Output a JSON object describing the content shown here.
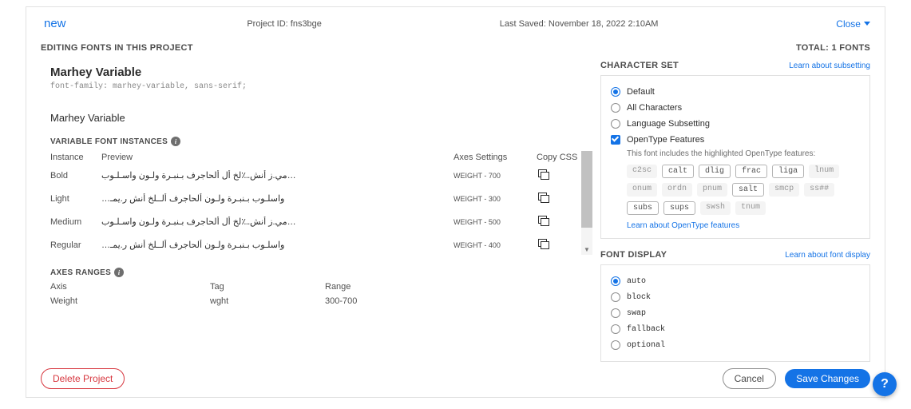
{
  "header": {
    "project_name": "new",
    "project_id_label": "Project ID:",
    "project_id": "fns3bge",
    "last_saved_label": "Last Saved:",
    "last_saved": "November 18, 2022 2:10AM",
    "close_label": "Close"
  },
  "row2": {
    "editing_label": "EDITING FONTS IN THIS PROJECT",
    "total_label": "TOTAL: 1 FONTS"
  },
  "font": {
    "name": "Marhey Variable",
    "css": "font-family: marhey-variable, sans-serif;",
    "sub_name": "Marhey Variable",
    "instances_label": "VARIABLE FONT INSTANCES",
    "cols": {
      "instance": "Instance",
      "preview": "Preview",
      "axes": "Axes Settings",
      "copy": "Copy CSS"
    },
    "instances": [
      {
        "name": "Bold",
        "preview": "…مي.ز أنش؊لخ أل ألحاجرف بـنبـرة ولـون واسـلـوب",
        "axes": "WEIGHT - 700"
      },
      {
        "name": "Light",
        "preview": "واسلـوب بـنبـرة ولـون ألحاجرف ألــلخ أنش ر.يمـ…",
        "axes": "WEIGHT - 300"
      },
      {
        "name": "Medium",
        "preview": "…مي.ز أنش؊لخ أل ألحاجرف بـنبـرة ولـون واسـلـوب",
        "axes": "WEIGHT - 500"
      },
      {
        "name": "Regular",
        "preview": "واسلـوب بـنبـرة ولـون ألحاجرف ألــلخ أنش ر.يمـ…",
        "axes": "WEIGHT - 400"
      }
    ],
    "axes_ranges_label": "AXES RANGES",
    "range_cols": {
      "axis": "Axis",
      "tag": "Tag",
      "range": "Range"
    },
    "ranges": [
      {
        "axis": "Weight",
        "tag": "wght",
        "range": "300-700"
      }
    ]
  },
  "charset": {
    "title": "CHARACTER SET",
    "learn": "Learn about subsetting",
    "options": [
      {
        "label": "Default",
        "checked": true,
        "type": "radio"
      },
      {
        "label": "All Characters",
        "checked": false,
        "type": "radio"
      },
      {
        "label": "Language Subsetting",
        "checked": false,
        "type": "radio"
      },
      {
        "label": "OpenType Features",
        "checked": true,
        "type": "check"
      }
    ],
    "ot_note": "This font includes the highlighted OpenType features:",
    "features": [
      {
        "tag": "c2sc",
        "on": false
      },
      {
        "tag": "calt",
        "on": true
      },
      {
        "tag": "dlig",
        "on": true
      },
      {
        "tag": "frac",
        "on": true
      },
      {
        "tag": "liga",
        "on": true
      },
      {
        "tag": "lnum",
        "on": false
      },
      {
        "tag": "onum",
        "on": false
      },
      {
        "tag": "ordn",
        "on": false
      },
      {
        "tag": "pnum",
        "on": false
      },
      {
        "tag": "salt",
        "on": true
      },
      {
        "tag": "smcp",
        "on": false
      },
      {
        "tag": "ss##",
        "on": false
      },
      {
        "tag": "subs",
        "on": true
      },
      {
        "tag": "sups",
        "on": true
      },
      {
        "tag": "swsh",
        "on": false
      },
      {
        "tag": "tnum",
        "on": false
      }
    ],
    "ot_link": "Learn about OpenType features"
  },
  "fontdisplay": {
    "title": "FONT DISPLAY",
    "learn": "Learn about font display",
    "options": [
      {
        "label": "auto",
        "checked": true
      },
      {
        "label": "block",
        "checked": false
      },
      {
        "label": "swap",
        "checked": false
      },
      {
        "label": "fallback",
        "checked": false
      },
      {
        "label": "optional",
        "checked": false
      }
    ]
  },
  "footer": {
    "delete": "Delete Project",
    "cancel": "Cancel",
    "save": "Save Changes",
    "help": "?"
  }
}
